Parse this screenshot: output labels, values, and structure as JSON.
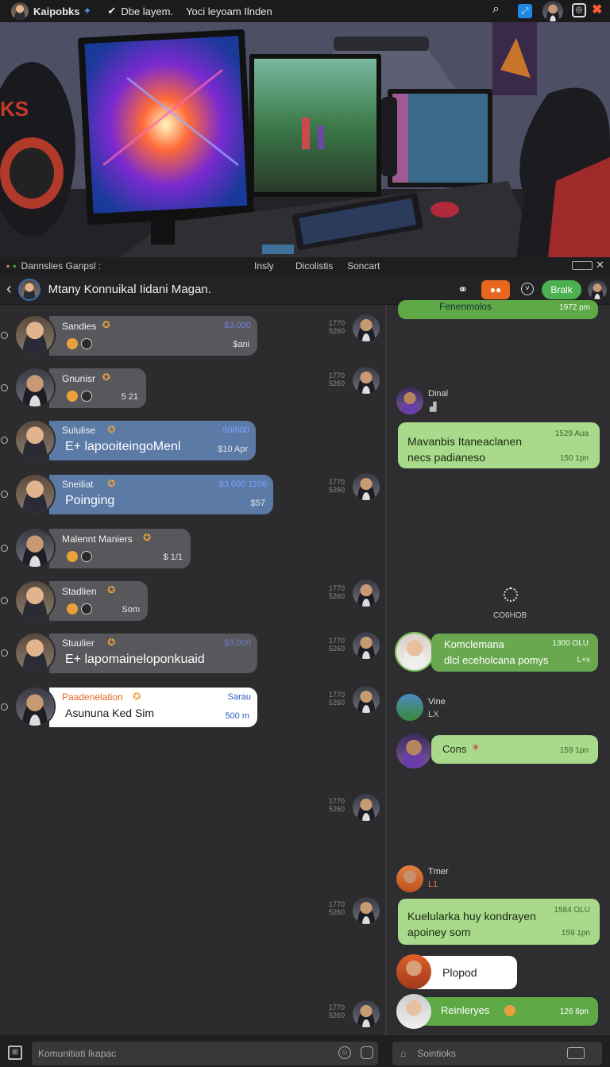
{
  "topbar": {
    "app_name": "Kaipobks",
    "item1": "Dbe layem.",
    "item2": "Yoci leyoam Ilnden"
  },
  "strip": {
    "title": "Dannslies Ganpsl :",
    "tabs": [
      "Insly",
      "Dicolistis",
      "Soncart"
    ]
  },
  "header": {
    "title": "Mtany Konnuikal Iidani Magan.",
    "call_label": "Bralk"
  },
  "left_messages": [
    {
      "name": "Sandies",
      "meta": "$3.000",
      "sub": "$ani",
      "ts": [
        "1770",
        "5260"
      ],
      "style": "grey"
    },
    {
      "name": "Gnunisr",
      "meta": "",
      "sub": "5 21",
      "ts": [
        "1770",
        "5260"
      ],
      "style": "grey"
    },
    {
      "name": "Sululise",
      "meta": "90/000",
      "body": "E+ lapooiteingoMenl",
      "sub": "$10 Apr",
      "ts": [],
      "style": "blue"
    },
    {
      "name": "Sneiliat",
      "meta": "$3.000 1106",
      "body": "Poinging",
      "sub": "$57",
      "ts": [
        "1770",
        "5260"
      ],
      "style": "blue"
    },
    {
      "name": "Malennt Maniers",
      "meta": "",
      "sub": "$ 1/1",
      "ts": [],
      "style": "grey"
    },
    {
      "name": "Stadlien",
      "meta": "",
      "sub": "Som",
      "ts": [
        "1770",
        "5260"
      ],
      "style": "grey"
    },
    {
      "name": "Stuulier",
      "meta": "$3.000",
      "body": "E+ lapomaineloponkuaid",
      "sub": "",
      "ts": [
        "1770",
        "5260"
      ],
      "style": "grey"
    },
    {
      "name": "Paadenelation",
      "meta": "Sarau",
      "body": "Asununa Ked Sim",
      "sub": "500 m",
      "ts": [
        "1770",
        "5260"
      ],
      "style": "white"
    }
  ],
  "extra_timestamps": [
    [
      "1770",
      "5260"
    ],
    [
      "1770",
      "5260"
    ],
    [
      "1770",
      "5260"
    ]
  ],
  "right": {
    "top_time": "1972 pm",
    "top_text": "Fenenmolos",
    "dinal_name": "Dinal",
    "bubble1": {
      "text": "Mavanbis Itaneaclanen necs padianeso",
      "time1": "1529 Aua",
      "time2": "150 1pn"
    },
    "loading_label": "CO6HOB",
    "bubble2": {
      "title": "Komclemana",
      "text": "dlcl eceholcana pomys",
      "time": "1300 OLU",
      "tail": "L+x"
    },
    "vine": {
      "name": "Vine",
      "sub": "LX"
    },
    "cons": {
      "text": "Cons",
      "time": "159 1pn"
    },
    "tmer": {
      "name": "Tmer",
      "sub": "L1"
    },
    "bubble3": {
      "text": "Kuelularka huy kondrayen apoiney som",
      "time1": "1584 OLU",
      "time2": "159 1pn"
    },
    "plopod": "Plopod",
    "reinleryes": {
      "text": "Reinleryes",
      "time": "126 8pn"
    }
  },
  "footer": {
    "left_placeholder": "Komunitiati Ikapac",
    "right_placeholder": "Sointioks"
  },
  "colors": {
    "green_light": "#a9d98a",
    "green_dark": "#6aa84f",
    "orange": "#e8661e",
    "blue_bubble": "#5b7aa6"
  }
}
